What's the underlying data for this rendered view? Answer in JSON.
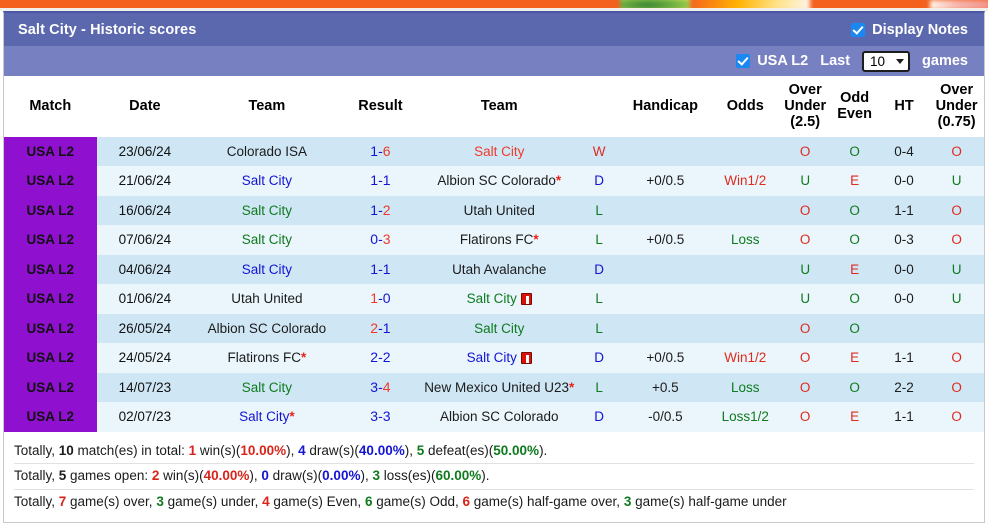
{
  "header": {
    "title": "Salt City - Historic scores",
    "display_notes_label": "Display Notes",
    "display_notes_checked": true,
    "league_label": "USA L2",
    "league_checked": true,
    "last_label": "Last",
    "games_count": "10",
    "games_label": "games"
  },
  "columns": {
    "match": "Match",
    "date": "Date",
    "team_home": "Team",
    "result": "Result",
    "team_away": "Team",
    "handicap": "Handicap",
    "odds": "Odds",
    "over_under_25_l1": "Over",
    "over_under_25_l2": "Under",
    "over_under_25_l3": "(2.5)",
    "odd_even_l1": "Odd",
    "odd_even_l2": "Even",
    "ht": "HT",
    "over_under_075_l1": "Over",
    "over_under_075_l2": "Under",
    "over_under_075_l3": "(0.75)"
  },
  "rows": [
    {
      "match": "USA L2",
      "date": "23/06/24",
      "home": "Colorado ISA",
      "home_color": "black",
      "home_star": false,
      "home_card": false,
      "score_left": "1",
      "score_right": "6",
      "score_hi": "right",
      "away": "Salt City",
      "away_color": "red",
      "away_star": false,
      "away_card": false,
      "wdl": "W",
      "wdl_color": "red",
      "handicap": "",
      "odds": "",
      "odds_color": "",
      "ou25": "O",
      "ou25_color": "red",
      "oddeven": "O",
      "oddeven_color": "green",
      "ht": "0-4",
      "ou075": "O",
      "ou075_color": "red"
    },
    {
      "match": "USA L2",
      "date": "21/06/24",
      "home": "Salt City",
      "home_color": "blue",
      "home_star": false,
      "home_card": false,
      "score_left": "1",
      "score_right": "1",
      "score_hi": "none",
      "away": "Albion SC Colorado",
      "away_color": "black",
      "away_star": true,
      "away_card": false,
      "wdl": "D",
      "wdl_color": "blue",
      "handicap": "+0/0.5",
      "odds": "Win1/2",
      "odds_color": "red",
      "ou25": "U",
      "ou25_color": "green",
      "oddeven": "E",
      "oddeven_color": "red",
      "ht": "0-0",
      "ou075": "U",
      "ou075_color": "green"
    },
    {
      "match": "USA L2",
      "date": "16/06/24",
      "home": "Salt City",
      "home_color": "green",
      "home_star": false,
      "home_card": false,
      "score_left": "1",
      "score_right": "2",
      "score_hi": "right",
      "away": "Utah United",
      "away_color": "black",
      "away_star": false,
      "away_card": false,
      "wdl": "L",
      "wdl_color": "green",
      "handicap": "",
      "odds": "",
      "odds_color": "",
      "ou25": "O",
      "ou25_color": "red",
      "oddeven": "O",
      "oddeven_color": "green",
      "ht": "1-1",
      "ou075": "O",
      "ou075_color": "red"
    },
    {
      "match": "USA L2",
      "date": "07/06/24",
      "home": "Salt City",
      "home_color": "green",
      "home_star": false,
      "home_card": false,
      "score_left": "0",
      "score_right": "3",
      "score_hi": "right",
      "away": "Flatirons FC",
      "away_color": "black",
      "away_star": true,
      "away_card": false,
      "wdl": "L",
      "wdl_color": "green",
      "handicap": "+0/0.5",
      "odds": "Loss",
      "odds_color": "green",
      "ou25": "O",
      "ou25_color": "red",
      "oddeven": "O",
      "oddeven_color": "green",
      "ht": "0-3",
      "ou075": "O",
      "ou075_color": "red"
    },
    {
      "match": "USA L2",
      "date": "04/06/24",
      "home": "Salt City",
      "home_color": "blue",
      "home_star": false,
      "home_card": false,
      "score_left": "1",
      "score_right": "1",
      "score_hi": "none",
      "away": "Utah Avalanche",
      "away_color": "black",
      "away_star": false,
      "away_card": false,
      "wdl": "D",
      "wdl_color": "blue",
      "handicap": "",
      "odds": "",
      "odds_color": "",
      "ou25": "U",
      "ou25_color": "green",
      "oddeven": "E",
      "oddeven_color": "red",
      "ht": "0-0",
      "ou075": "U",
      "ou075_color": "green"
    },
    {
      "match": "USA L2",
      "date": "01/06/24",
      "home": "Utah United",
      "home_color": "black",
      "home_star": false,
      "home_card": false,
      "score_left": "1",
      "score_right": "0",
      "score_hi": "left",
      "away": "Salt City",
      "away_color": "green",
      "away_star": false,
      "away_card": true,
      "wdl": "L",
      "wdl_color": "green",
      "handicap": "",
      "odds": "",
      "odds_color": "",
      "ou25": "U",
      "ou25_color": "green",
      "oddeven": "O",
      "oddeven_color": "green",
      "ht": "0-0",
      "ou075": "U",
      "ou075_color": "green"
    },
    {
      "match": "USA L2",
      "date": "26/05/24",
      "home": "Albion SC Colorado",
      "home_color": "black",
      "home_star": false,
      "home_card": false,
      "score_left": "2",
      "score_right": "1",
      "score_hi": "left",
      "away": "Salt City",
      "away_color": "green",
      "away_star": false,
      "away_card": false,
      "wdl": "L",
      "wdl_color": "green",
      "handicap": "",
      "odds": "",
      "odds_color": "",
      "ou25": "O",
      "ou25_color": "red",
      "oddeven": "O",
      "oddeven_color": "green",
      "ht": "",
      "ou075": "",
      "ou075_color": ""
    },
    {
      "match": "USA L2",
      "date": "24/05/24",
      "home": "Flatirons FC",
      "home_color": "black",
      "home_star": true,
      "home_card": false,
      "score_left": "2",
      "score_right": "2",
      "score_hi": "none",
      "away": "Salt City",
      "away_color": "blue",
      "away_star": false,
      "away_card": true,
      "wdl": "D",
      "wdl_color": "blue",
      "handicap": "+0/0.5",
      "odds": "Win1/2",
      "odds_color": "red",
      "ou25": "O",
      "ou25_color": "red",
      "oddeven": "E",
      "oddeven_color": "red",
      "ht": "1-1",
      "ou075": "O",
      "ou075_color": "red"
    },
    {
      "match": "USA L2",
      "date": "14/07/23",
      "home": "Salt City",
      "home_color": "green",
      "home_star": false,
      "home_card": false,
      "score_left": "3",
      "score_right": "4",
      "score_hi": "right",
      "away": "New Mexico United U23",
      "away_color": "black",
      "away_star": true,
      "away_card": false,
      "wdl": "L",
      "wdl_color": "green",
      "handicap": "+0.5",
      "odds": "Loss",
      "odds_color": "green",
      "ou25": "O",
      "ou25_color": "red",
      "oddeven": "O",
      "oddeven_color": "green",
      "ht": "2-2",
      "ou075": "O",
      "ou075_color": "red"
    },
    {
      "match": "USA L2",
      "date": "02/07/23",
      "home": "Salt City",
      "home_color": "blue",
      "home_star": true,
      "home_card": false,
      "score_left": "3",
      "score_right": "3",
      "score_hi": "none",
      "away": "Albion SC Colorado",
      "away_color": "black",
      "away_star": false,
      "away_card": false,
      "wdl": "D",
      "wdl_color": "blue",
      "handicap": "-0/0.5",
      "odds": "Loss1/2",
      "odds_color": "green",
      "ou25": "O",
      "ou25_color": "red",
      "oddeven": "E",
      "oddeven_color": "red",
      "ht": "1-1",
      "ou075": "O",
      "ou075_color": "red"
    }
  ],
  "notes": {
    "line1": {
      "t0": "Totally, ",
      "v1": "10",
      "t1": " match(es) in total: ",
      "v2": "1",
      "t2": " win(s)(",
      "v3": "10.00%",
      "t3": "), ",
      "v4": "4",
      "t4": " draw(s)(",
      "v5": "40.00%",
      "t5": "), ",
      "v6": "5",
      "t6": " defeat(es)(",
      "v7": "50.00%",
      "t7": ")."
    },
    "line2": {
      "t0": "Totally, ",
      "v1": "5",
      "t1": " games open: ",
      "v2": "2",
      "t2": " win(s)(",
      "v3": "40.00%",
      "t3": "), ",
      "v4": "0",
      "t4": " draw(s)(",
      "v5": "0.00%",
      "t5": "), ",
      "v6": "3",
      "t6": " loss(es)(",
      "v7": "60.00%",
      "t7": ")."
    },
    "line3": {
      "t0": "Totally, ",
      "v1": "7",
      "t1": " game(s) over, ",
      "v2": "3",
      "t2": " game(s) under, ",
      "v3": "4",
      "t3": " game(s) Even, ",
      "v4": "6",
      "t4": " game(s) Odd, ",
      "v5": "6",
      "t5": " game(s) half-game over, ",
      "v6": "3",
      "t6": " game(s) half-game under"
    }
  }
}
